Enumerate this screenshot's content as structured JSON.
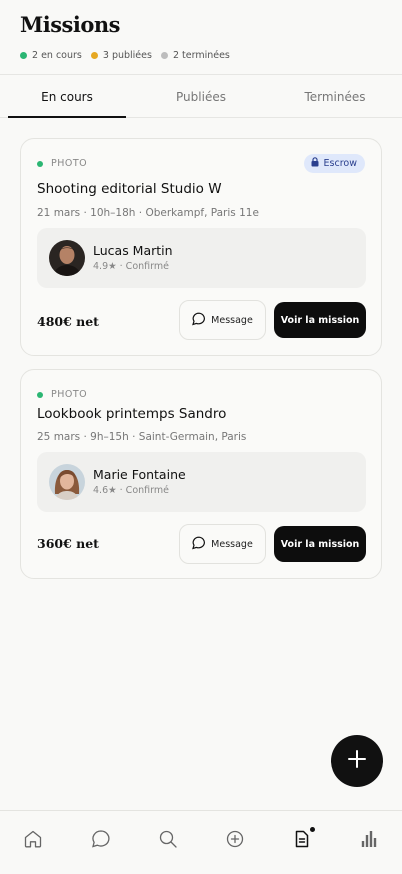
{
  "header": {
    "title": "Missions",
    "stats": [
      {
        "label": "2 en cours",
        "color": "#2bb673"
      },
      {
        "label": "3 publiées",
        "color": "#e6a822"
      },
      {
        "label": "2 terminées",
        "color": "#bdbdbd"
      }
    ]
  },
  "tabs": [
    {
      "label": "En cours",
      "active": true
    },
    {
      "label": "Publiées",
      "active": false
    },
    {
      "label": "Terminées",
      "active": false
    }
  ],
  "missions": [
    {
      "category": "PHOTO",
      "badge": "Escrow",
      "title": "Shooting editorial Studio W",
      "meta": "21 mars · 10h–18h · Oberkampf, Paris 11e",
      "person": {
        "name": "Lucas Martin",
        "rating": "4.9★ · Confirmé"
      },
      "price": "480€ net",
      "message_label": "Message",
      "cta_label": "Voir la mission"
    },
    {
      "category": "PHOTO",
      "title": "Lookbook printemps Sandro",
      "meta": "25 mars · 9h–15h · Saint-Germain, Paris",
      "person": {
        "name": "Marie Fontaine",
        "rating": "4.6★ · Confirmé"
      },
      "price": "360€ net",
      "message_label": "Message",
      "cta_label": "Voir la mission"
    }
  ],
  "nav": [
    {
      "icon": "home-icon"
    },
    {
      "icon": "chat-icon"
    },
    {
      "icon": "search-icon"
    },
    {
      "icon": "plus-circle-icon"
    },
    {
      "icon": "document-icon",
      "active": true
    },
    {
      "icon": "bar-chart-icon"
    }
  ],
  "colors": {
    "accent": "#111111",
    "status_active": "#2bb673",
    "escrow_bg": "#dfe8fb"
  }
}
